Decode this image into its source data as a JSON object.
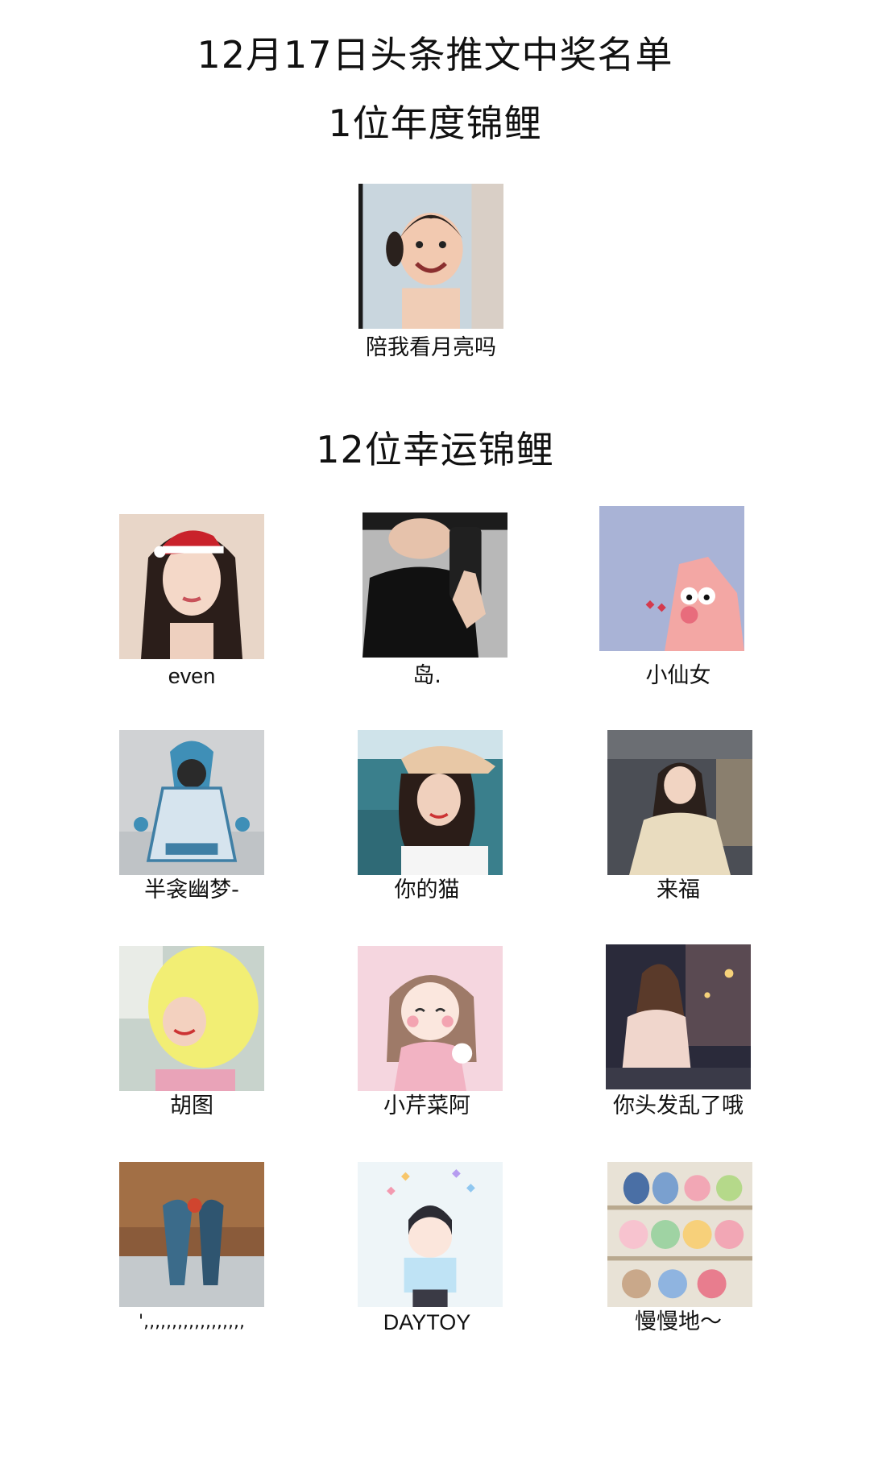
{
  "header": {
    "title": "12月17日头条推文中奖名单",
    "grand_heading": "1位年度锦鲤",
    "lucky_heading": "12位幸运锦鲤"
  },
  "grand_winner": {
    "name": "陪我看月亮吗",
    "avatar": "child-face-avatar"
  },
  "lucky_winners": [
    {
      "name": "even",
      "avatar": "girl-santa-hat-avatar"
    },
    {
      "name": "岛.",
      "avatar": "phone-mirror-selfie-avatar"
    },
    {
      "name": "小仙女",
      "avatar": "pink-starfish-cartoon-avatar"
    },
    {
      "name": "半衾幽梦-",
      "avatar": "penguin-costume-avatar"
    },
    {
      "name": "你的猫",
      "avatar": "girl-straw-hat-seaside-avatar"
    },
    {
      "name": "来福",
      "avatar": "girl-sweater-mall-avatar"
    },
    {
      "name": "胡图",
      "avatar": "lemon-hat-avatar"
    },
    {
      "name": "小芹菜阿",
      "avatar": "anime-girl-pink-avatar"
    },
    {
      "name": "你头发乱了哦",
      "avatar": "girl-night-street-avatar"
    },
    {
      "name": "',,,,,,,,,,,,,,,,,,",
      "avatar": "couple-forest-avatar"
    },
    {
      "name": "DAYTOY",
      "avatar": "cartoon-boy-hearts-avatar"
    },
    {
      "name": "慢慢地～",
      "avatar": "plush-toys-shelf-avatar"
    }
  ]
}
